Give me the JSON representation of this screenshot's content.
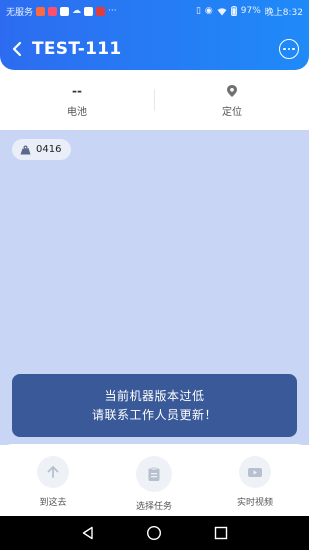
{
  "status_bar": {
    "carrier": "无服务",
    "battery": "97%",
    "time": "晚上8:32"
  },
  "header": {
    "title": "TEST-111",
    "back_icon": "chevron-left-icon",
    "more_icon": "more-horizontal-icon"
  },
  "stats": {
    "battery_value": "--",
    "battery_label": "电池",
    "location_label": "定位"
  },
  "map": {
    "chip_label": "0416"
  },
  "toast": {
    "line1": "当前机器版本过低",
    "line2": "请联系工作人员更新！"
  },
  "actions": [
    {
      "label": "到这去",
      "icon": "arrow-up-icon"
    },
    {
      "label": "选择任务",
      "icon": "clipboard-icon"
    },
    {
      "label": "实时视频",
      "icon": "video-camera-icon"
    }
  ],
  "colors": {
    "header_start": "#2d6cf0",
    "header_end": "#1f8af8",
    "map_bg": "#c8d5f4",
    "toast_bg": "#3a5998"
  }
}
